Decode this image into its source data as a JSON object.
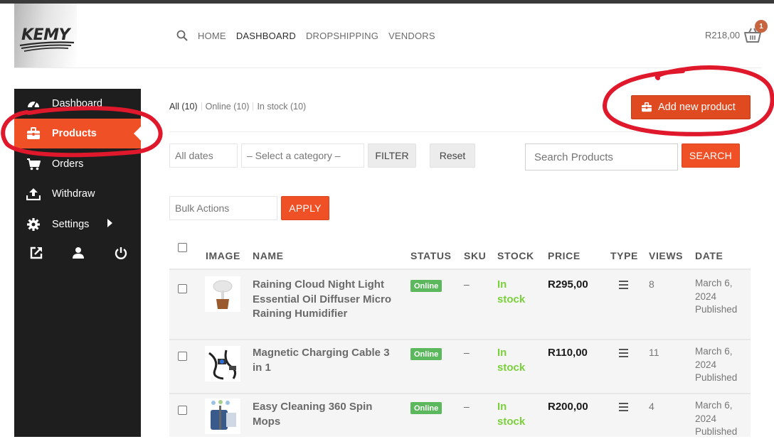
{
  "header": {
    "logo_text": "KEMY",
    "nav": [
      "HOME",
      "DASHBOARD",
      "DROPSHIPPING",
      "VENDORS"
    ],
    "cart_total": "R218,00",
    "cart_count": "1"
  },
  "sidebar": {
    "items": [
      {
        "label": "Dashboard",
        "icon": "dashboard-icon"
      },
      {
        "label": "Products",
        "icon": "briefcase-icon"
      },
      {
        "label": "Orders",
        "icon": "cart-icon"
      },
      {
        "label": "Withdraw",
        "icon": "upload-icon"
      },
      {
        "label": "Settings",
        "icon": "gear-icon"
      }
    ],
    "footer_icons": [
      "external-link-icon",
      "user-icon",
      "power-icon"
    ]
  },
  "filters": {
    "tabs": [
      "All (10)",
      "Online (10)",
      "In stock (10)"
    ],
    "add_button": "Add new product",
    "dates": "All dates",
    "category": "– Select a category –",
    "filter_button": "FILTER",
    "reset_button": "Reset",
    "search_placeholder": "Search Products",
    "search_button": "SEARCH",
    "bulk_actions": "Bulk Actions",
    "apply_button": "APPLY"
  },
  "table": {
    "columns": [
      "IMAGE",
      "NAME",
      "STATUS",
      "SKU",
      "STOCK",
      "PRICE",
      "TYPE",
      "VIEWS",
      "DATE"
    ],
    "rows": [
      {
        "name": [
          "Raining Cloud Night Light",
          "Essential Oil Diffuser Micro",
          "Raining Humidifier"
        ],
        "status": "Online",
        "sku": "–",
        "stock": [
          "In",
          "stock"
        ],
        "price": "R295,00",
        "views": "8",
        "date": [
          "March 6,",
          "2024",
          "Published"
        ]
      },
      {
        "name": [
          "Magnetic Charging Cable 3",
          "in 1"
        ],
        "status": "Online",
        "sku": "–",
        "stock": [
          "In",
          "stock"
        ],
        "price": "R110,00",
        "views": "11",
        "date": [
          "March 6,",
          "2024",
          "Published"
        ]
      },
      {
        "name": [
          "Easy Cleaning 360 Spin",
          "Mops"
        ],
        "status": "Online",
        "sku": "–",
        "stock": [
          "In",
          "stock"
        ],
        "price": "R200,00",
        "views": "4",
        "date": [
          "March 6,",
          "2024",
          "Published"
        ]
      }
    ]
  },
  "colors": {
    "accent": "#f05025",
    "sidebar_bg": "#1e1e1e",
    "online_badge": "#5cb85c",
    "in_stock": "#7ad03a",
    "annotation": "#e0182b"
  }
}
